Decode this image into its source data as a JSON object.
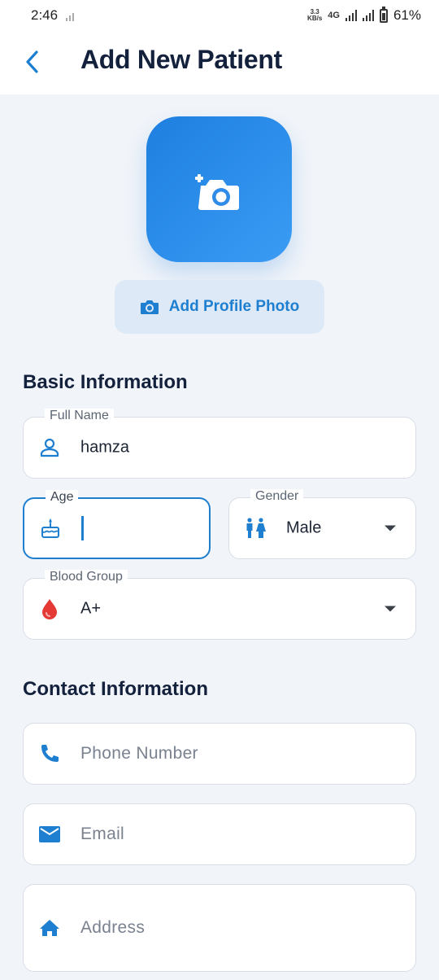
{
  "status_bar": {
    "time": "2:46",
    "net_speed_value": "3.3",
    "net_speed_unit": "KB/s",
    "network_type": "4G",
    "battery_percent": "61%"
  },
  "app_bar": {
    "title": "Add New Patient",
    "back_icon": "arrow-back-icon"
  },
  "photo": {
    "icon": "add-a-photo-icon",
    "button_label": "Add Profile Photo",
    "button_icon": "camera-icon"
  },
  "basic_info": {
    "heading": "Basic Information",
    "full_name": {
      "label": "Full Name",
      "value": "hamza",
      "icon": "person-icon"
    },
    "age": {
      "label": "Age",
      "value": "",
      "icon": "cake-icon"
    },
    "gender": {
      "label": "Gender",
      "value": "Male",
      "icon": "wc-icon"
    },
    "blood_group": {
      "label": "Blood Group",
      "value": "A+",
      "icon": "blood-drop-icon"
    }
  },
  "contact_info": {
    "heading": "Contact Information",
    "phone": {
      "placeholder": "Phone Number",
      "icon": "phone-icon"
    },
    "email": {
      "placeholder": "Email",
      "icon": "email-icon"
    },
    "address": {
      "placeholder": "Address",
      "icon": "home-icon"
    }
  },
  "colors": {
    "accent": "#1E7FD0",
    "background": "#F1F4F9",
    "blood_red": "#E53935"
  }
}
